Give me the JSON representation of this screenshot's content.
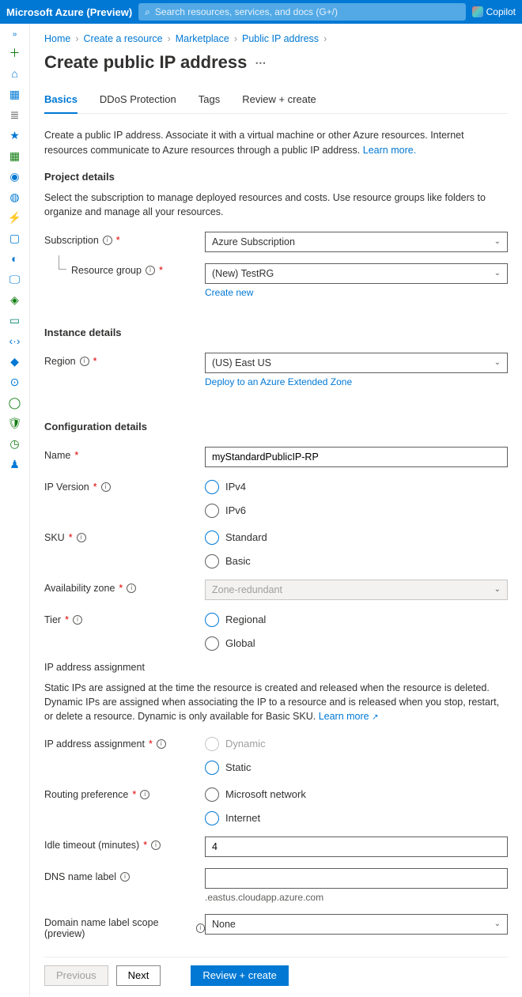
{
  "topbar": {
    "brand": "Microsoft Azure (Preview)",
    "search_placeholder": "Search resources, services, and docs (G+/)",
    "copilot_label": "Copilot"
  },
  "breadcrumbs": [
    "Home",
    "Create a resource",
    "Marketplace",
    "Public IP address"
  ],
  "page_title": "Create public IP address",
  "tabs": [
    "Basics",
    "DDoS Protection",
    "Tags",
    "Review + create"
  ],
  "intro": {
    "text": "Create a public IP address. Associate it with a virtual machine or other Azure resources. Internet resources communicate to Azure resources through a public IP address. ",
    "learn_more": "Learn more."
  },
  "project": {
    "heading": "Project details",
    "desc": "Select the subscription to manage deployed resources and costs. Use resource groups like folders to organize and manage all your resources.",
    "subscription_label": "Subscription",
    "subscription_value": "Azure Subscription",
    "rg_label": "Resource group",
    "rg_value": "(New) TestRG",
    "create_new": "Create new"
  },
  "instance": {
    "heading": "Instance details",
    "region_label": "Region",
    "region_value": "(US) East US",
    "extended_zone_link": "Deploy to an Azure Extended Zone"
  },
  "config": {
    "heading": "Configuration details",
    "name_label": "Name",
    "name_value": "myStandardPublicIP-RP",
    "ipver_label": "IP Version",
    "ipver_opts": [
      "IPv4",
      "IPv6"
    ],
    "sku_label": "SKU",
    "sku_opts": [
      "Standard",
      "Basic"
    ],
    "az_label": "Availability zone",
    "az_value": "Zone-redundant",
    "tier_label": "Tier",
    "tier_opts": [
      "Regional",
      "Global"
    ],
    "ipassign_head": "IP address assignment",
    "ipassign_desc": "Static IPs are assigned at the time the resource is created and released when the resource is deleted. Dynamic IPs are assigned when associating the IP to a resource and is released when you stop, restart, or delete a resource. Dynamic is only available for Basic SKU. ",
    "learn_more": "Learn more",
    "ipassign_label": "IP address assignment",
    "ipassign_opts": [
      "Dynamic",
      "Static"
    ],
    "routing_label": "Routing preference",
    "routing_opts": [
      "Microsoft network",
      "Internet"
    ],
    "idle_label": "Idle timeout (minutes)",
    "idle_value": "4",
    "dns_label": "DNS name label",
    "dns_suffix": ".eastus.cloudapp.azure.com",
    "scope_label": "Domain name label scope (preview)",
    "scope_value": "None"
  },
  "footer": {
    "previous": "Previous",
    "next": "Next",
    "review": "Review + create"
  }
}
